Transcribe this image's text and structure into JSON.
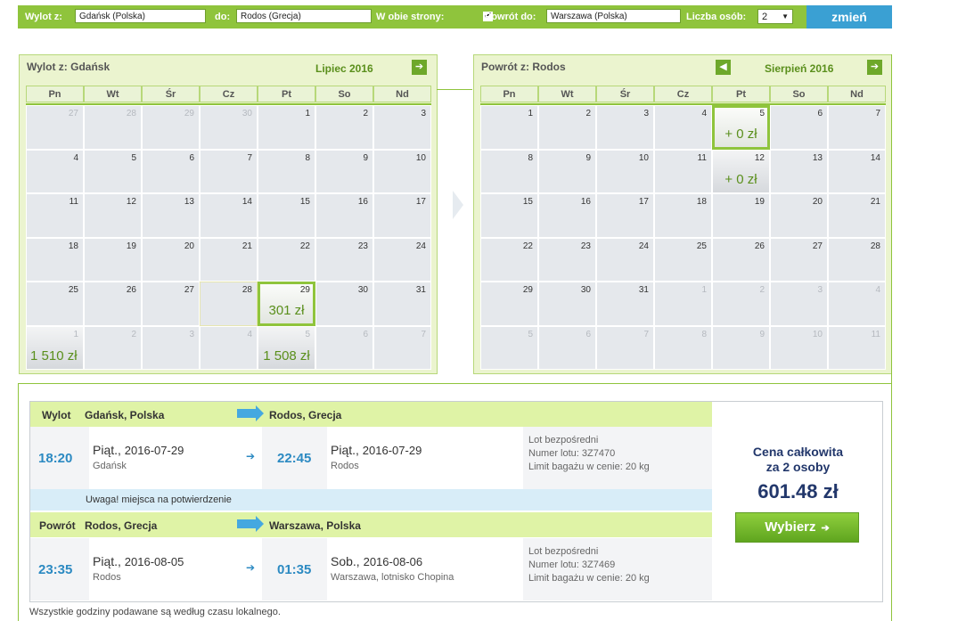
{
  "search": {
    "from_label": "Wylot z:",
    "from_value": "Gdańsk (Polska)",
    "to_label": "do:",
    "to_value": "Rodos (Grecja)",
    "round_trip_label": "W obie strony:",
    "round_trip_checked": "✔",
    "return_label": "Powrót do:",
    "return_value": "Warszawa (Polska)",
    "persons_label": "Liczba osób:",
    "persons_value": "2",
    "change_button": "zmień"
  },
  "outbound_calendar": {
    "title": "Wylot z: Gdańsk",
    "month": "Lipiec 2016",
    "next_icon": "➔",
    "weekdays": [
      "Pn",
      "Wt",
      "Śr",
      "Cz",
      "Pt",
      "So",
      "Nd"
    ],
    "days": [
      {
        "n": "27",
        "other": true
      },
      {
        "n": "28",
        "other": true
      },
      {
        "n": "29",
        "other": true
      },
      {
        "n": "30",
        "other": true
      },
      {
        "n": "1"
      },
      {
        "n": "2"
      },
      {
        "n": "3"
      },
      {
        "n": "4"
      },
      {
        "n": "5"
      },
      {
        "n": "6"
      },
      {
        "n": "7"
      },
      {
        "n": "8"
      },
      {
        "n": "9"
      },
      {
        "n": "10"
      },
      {
        "n": "11"
      },
      {
        "n": "12"
      },
      {
        "n": "13"
      },
      {
        "n": "14"
      },
      {
        "n": "15"
      },
      {
        "n": "16"
      },
      {
        "n": "17"
      },
      {
        "n": "18"
      },
      {
        "n": "19"
      },
      {
        "n": "20"
      },
      {
        "n": "21"
      },
      {
        "n": "22"
      },
      {
        "n": "23"
      },
      {
        "n": "24"
      },
      {
        "n": "25"
      },
      {
        "n": "26"
      },
      {
        "n": "27"
      },
      {
        "n": "28",
        "range": true
      },
      {
        "n": "29",
        "price": "301 zł",
        "selected": true
      },
      {
        "n": "30"
      },
      {
        "n": "31"
      },
      {
        "n": "1",
        "other": true,
        "price": "1 510 zł",
        "left": true
      },
      {
        "n": "2",
        "other": true
      },
      {
        "n": "3",
        "other": true
      },
      {
        "n": "4",
        "other": true
      },
      {
        "n": "5",
        "other": true,
        "price": "1 508 zł"
      },
      {
        "n": "6",
        "other": true
      },
      {
        "n": "7",
        "other": true
      }
    ]
  },
  "return_calendar": {
    "title": "Powrót z: Rodos",
    "month": "Sierpień 2016",
    "prev_icon": "🡐",
    "next_icon": "➔",
    "weekdays": [
      "Pn",
      "Wt",
      "Śr",
      "Cz",
      "Pt",
      "So",
      "Nd"
    ],
    "days": [
      {
        "n": "1"
      },
      {
        "n": "2"
      },
      {
        "n": "3"
      },
      {
        "n": "4"
      },
      {
        "n": "5",
        "price": "+ 0 zł",
        "selected": true
      },
      {
        "n": "6"
      },
      {
        "n": "7"
      },
      {
        "n": "8"
      },
      {
        "n": "9"
      },
      {
        "n": "10"
      },
      {
        "n": "11"
      },
      {
        "n": "12",
        "price": "+ 0 zł"
      },
      {
        "n": "13"
      },
      {
        "n": "14"
      },
      {
        "n": "15"
      },
      {
        "n": "16"
      },
      {
        "n": "17"
      },
      {
        "n": "18"
      },
      {
        "n": "19"
      },
      {
        "n": "20"
      },
      {
        "n": "21"
      },
      {
        "n": "22"
      },
      {
        "n": "23"
      },
      {
        "n": "24"
      },
      {
        "n": "25"
      },
      {
        "n": "26"
      },
      {
        "n": "27"
      },
      {
        "n": "28"
      },
      {
        "n": "29"
      },
      {
        "n": "30"
      },
      {
        "n": "31"
      },
      {
        "n": "1",
        "other": true
      },
      {
        "n": "2",
        "other": true
      },
      {
        "n": "3",
        "other": true
      },
      {
        "n": "4",
        "other": true
      },
      {
        "n": "5",
        "other": true
      },
      {
        "n": "6",
        "other": true
      },
      {
        "n": "7",
        "other": true
      },
      {
        "n": "8",
        "other": true
      },
      {
        "n": "9",
        "other": true
      },
      {
        "n": "10",
        "other": true
      },
      {
        "n": "11",
        "other": true
      }
    ]
  },
  "outbound": {
    "label": "Wylot",
    "from": "Gdańsk, Polska",
    "to": "Rodos, Grecja",
    "dep_time": "18:20",
    "dep_day": "Piąt.,",
    "dep_date": "2016-07-29",
    "dep_city": "Gdańsk",
    "arr_time": "22:45",
    "arr_day": "Piąt.,",
    "arr_date": "2016-07-29",
    "arr_city": "Rodos",
    "info1": "Lot bezpośredni",
    "info2": "Numer lotu: 3Z7470",
    "info3": "Limit bagażu w cenie: 20 kg"
  },
  "notice": "Uwaga! miejsca na potwierdzenie",
  "return": {
    "label": "Powrót",
    "from": "Rodos, Grecja",
    "to": "Warszawa, Polska",
    "dep_time": "23:35",
    "dep_day": "Piąt.,",
    "dep_date": "2016-08-05",
    "dep_city": "Rodos",
    "arr_time": "01:35",
    "arr_day": "Sob.,",
    "arr_date": "2016-08-06",
    "arr_city": "Warszawa, lotnisko Chopina",
    "info1": "Lot bezpośredni",
    "info2": "Numer lotu: 3Z7469",
    "info3": "Limit bagażu w cenie: 20 kg"
  },
  "price": {
    "title_line1": "Cena całkowita",
    "title_line2": "za 2 osoby",
    "value": "601.48 zł",
    "choose_button": "Wybierz",
    "choose_icon": "➔"
  },
  "footnote": "Wszystkie godziny podawane są według czasu lokalnego."
}
